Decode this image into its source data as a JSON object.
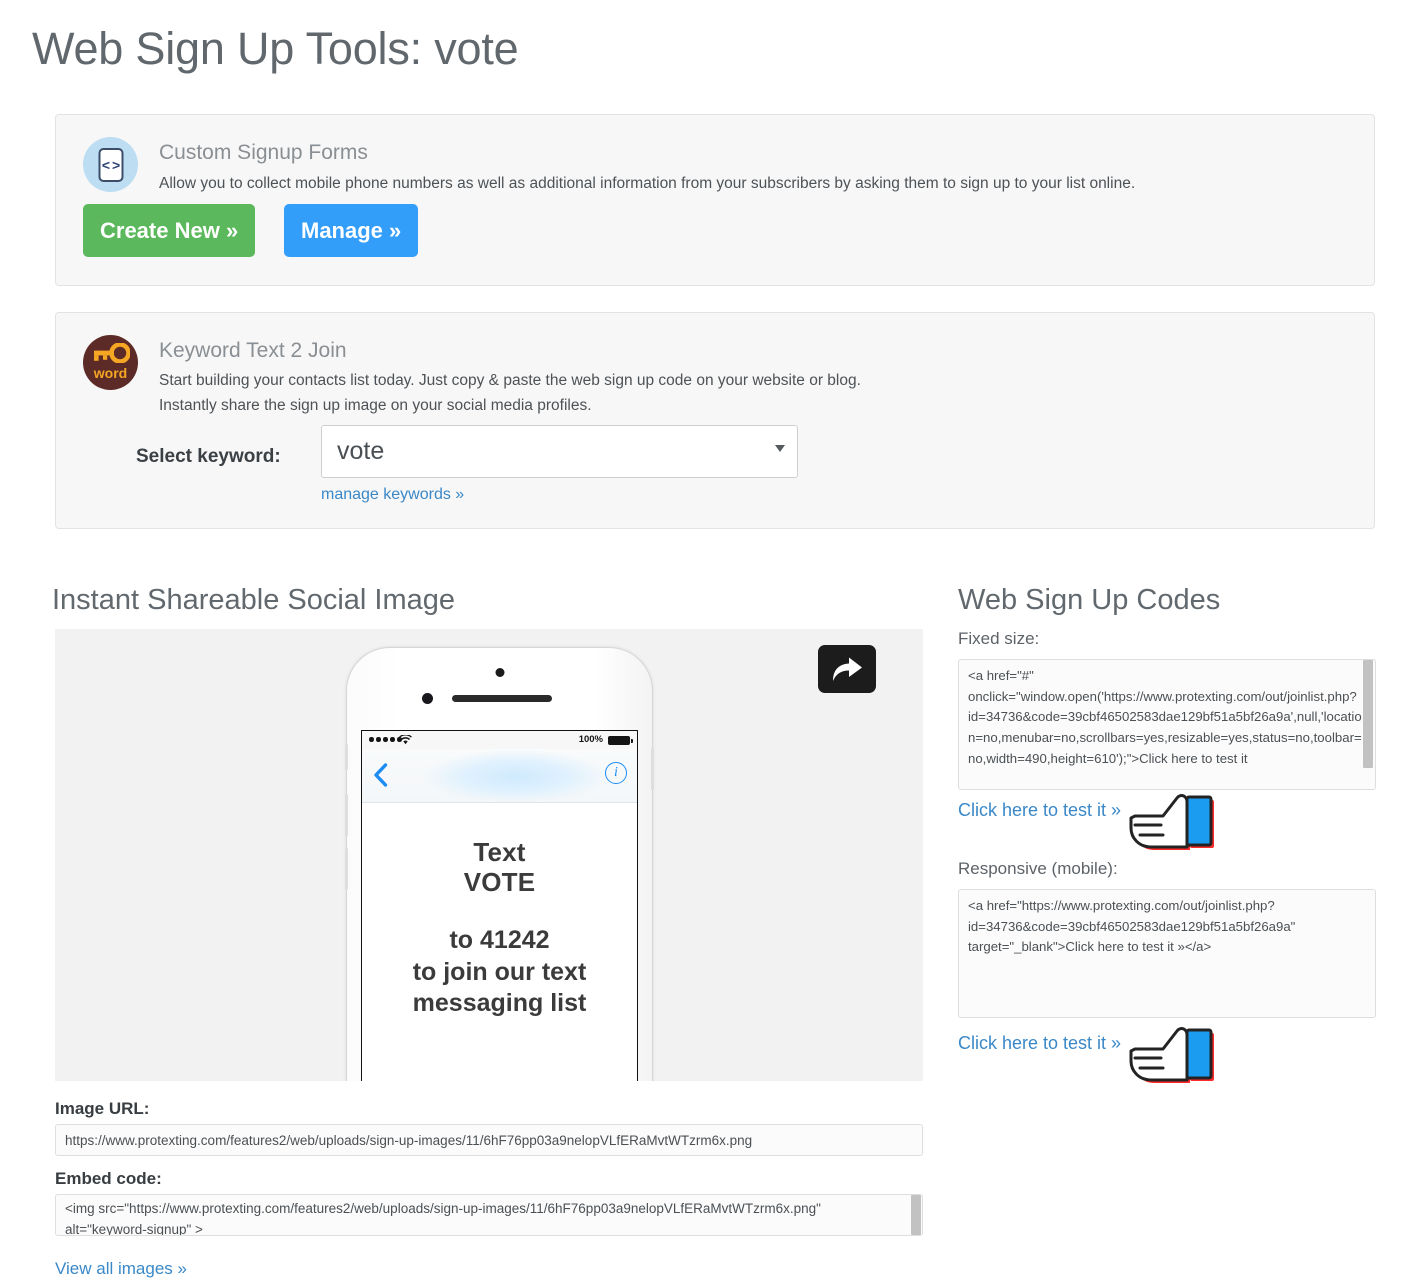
{
  "page": {
    "title": "Web Sign Up Tools: vote"
  },
  "signup_forms_panel": {
    "icon": "code-document-icon",
    "heading": "Custom Signup Forms",
    "description": "Allow you to collect mobile phone numbers as well as additional information from your subscribers by asking them to sign up to your list online.",
    "create_button": "Create New »",
    "manage_button": "Manage »",
    "create_button_color": "#5cb85c",
    "manage_button_color": "#339ef9"
  },
  "keyword_panel": {
    "icon": "keyword-key-icon",
    "icon_text": "word",
    "heading": "Keyword Text 2 Join",
    "description_line1": "Start building your contacts list today. Just copy & paste the web sign up code on your website or blog.",
    "description_line2": "Instantly share the sign up image on your social media profiles.",
    "select_label": "Select keyword:",
    "selected_keyword": "vote",
    "manage_keywords_link": "manage keywords »"
  },
  "social_image_section": {
    "heading": "Instant Shareable Social Image",
    "share_icon": "share-arrow-icon",
    "phone": {
      "signal_bars": 5,
      "wifi_icon": "wifi-icon",
      "battery_percent": "100%",
      "back_icon": "chevron-left-icon",
      "info_icon": "info-circle-icon",
      "line1": "Text",
      "line2": "VOTE",
      "line3": "to 41242",
      "line4": "to join our text",
      "line5": "messaging list"
    },
    "image_url_label": "Image URL:",
    "image_url_value": "https://www.protexting.com/features2/web/uploads/sign-up-images/11/6hF76pp03a9nelopVLfERaMvtWTzrm6x.png",
    "embed_code_label": "Embed code:",
    "embed_code_value": "<img src=\"https://www.protexting.com/features2/web/uploads/sign-up-images/11/6hF76pp03a9nelopVLfERaMvtWTzrm6x.png\"\nalt=\"keyword-signup\" >",
    "view_all_link": "View all images »"
  },
  "web_signup_codes": {
    "heading": "Web Sign Up Codes",
    "fixed_label": "Fixed size:",
    "fixed_code": "<a href=\"#\"\nonclick=\"window.open('https://www.protexting.com/out/joinlist.php?\nid=34736&code=39cbf46502583dae129bf51a5bf26a9a',null,'location=no,menubar=no,scrollbars=yes,resizable=yes,status=no,toolbar=no,width=490,height=610');\">Click here to test it",
    "fixed_test_link": "Click here to test it »",
    "responsive_label": "Responsive (mobile):",
    "responsive_code": "<a href=\"https://www.protexting.com/out/joinlist.php?\nid=34736&code=39cbf46502583dae129bf51a5bf26a9a\"\ntarget=\"_blank\">Click here to test it »</a>",
    "responsive_test_link": "Click here to test it »",
    "hand_icon": "pointing-hand-icon"
  }
}
